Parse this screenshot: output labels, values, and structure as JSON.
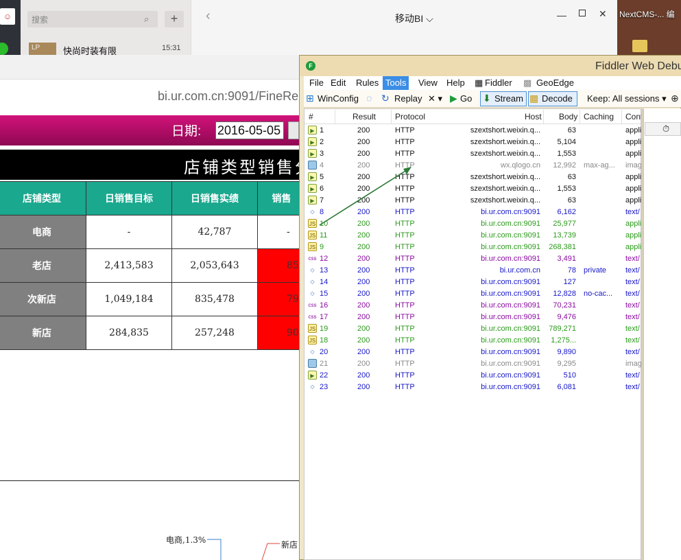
{
  "wechat": {
    "search_placeholder": "搜索",
    "add_label": "+",
    "chat_thumb": "LP",
    "chat_name": "快尚时装有限",
    "chat_time": "15:31",
    "window_title": "移动BI ⌵"
  },
  "desktop": {
    "icon_label": "NextCMS-...  编"
  },
  "browser": {
    "url": "bi.ur.com.cn:9091/FineRepo",
    "date_label": "日期:",
    "date_value": "2016-05-05",
    "report_title": "店铺类型销售分",
    "table": {
      "headers": [
        "店铺类型",
        "日销售目标",
        "日销售实绩",
        "销售"
      ],
      "rows": [
        {
          "type": "电商",
          "target": "-",
          "actual": "42,787",
          "rate": "-"
        },
        {
          "type": "老店",
          "target": "2,413,583",
          "actual": "2,053,643",
          "rate": "85"
        },
        {
          "type": "次新店",
          "target": "1,049,184",
          "actual": "835,478",
          "rate": "79"
        },
        {
          "type": "新店",
          "target": "284,835",
          "actual": "257,248",
          "rate": "90"
        }
      ]
    },
    "pie_labels": [
      "电商,1.3%",
      "新店"
    ]
  },
  "fiddler": {
    "title": "Fiddler Web Debu",
    "menu": [
      "File",
      "Edit",
      "Rules",
      "Tools",
      "View",
      "Help",
      "Fiddler",
      "GeoEdge"
    ],
    "active_menu": "Tools",
    "toolbar": {
      "winconfig": "WinConfig",
      "replay": "Replay",
      "remove": "✕ ▾",
      "go": "Go",
      "stream": "Stream",
      "decode": "Decode",
      "keep": "Keep: All sessions ▾"
    },
    "columns": [
      "#",
      "Result",
      "Protocol",
      "Host",
      "Body",
      "Caching",
      "Cont"
    ],
    "sessions": [
      {
        "id": "1",
        "result": "200",
        "protocol": "HTTP",
        "host": "szextshort.weixin.q...",
        "body": "63",
        "caching": "",
        "ctype": "appli",
        "icon": "resp",
        "color": "black"
      },
      {
        "id": "2",
        "result": "200",
        "protocol": "HTTP",
        "host": "szextshort.weixin.q...",
        "body": "5,104",
        "caching": "",
        "ctype": "appli",
        "icon": "resp",
        "color": "black"
      },
      {
        "id": "3",
        "result": "200",
        "protocol": "HTTP",
        "host": "szextshort.weixin.q...",
        "body": "1,553",
        "caching": "",
        "ctype": "appli",
        "icon": "resp",
        "color": "black"
      },
      {
        "id": "4",
        "result": "200",
        "protocol": "HTTP",
        "host": "wx.qlogo.cn",
        "body": "12,992",
        "caching": "max-ag...",
        "ctype": "imag",
        "icon": "img",
        "color": "gray"
      },
      {
        "id": "5",
        "result": "200",
        "protocol": "HTTP",
        "host": "szextshort.weixin.q...",
        "body": "63",
        "caching": "",
        "ctype": "appli",
        "icon": "resp",
        "color": "black"
      },
      {
        "id": "6",
        "result": "200",
        "protocol": "HTTP",
        "host": "szextshort.weixin.q...",
        "body": "1,553",
        "caching": "",
        "ctype": "appli",
        "icon": "resp",
        "color": "black"
      },
      {
        "id": "7",
        "result": "200",
        "protocol": "HTTP",
        "host": "szextshort.weixin.q...",
        "body": "63",
        "caching": "",
        "ctype": "appli",
        "icon": "resp",
        "color": "black"
      },
      {
        "id": "8",
        "result": "200",
        "protocol": "HTTP",
        "host": "bi.ur.com.cn:9091",
        "body": "6,162",
        "caching": "",
        "ctype": "text/",
        "icon": "html",
        "color": "blue"
      },
      {
        "id": "10",
        "result": "200",
        "protocol": "HTTP",
        "host": "bi.ur.com.cn:9091",
        "body": "25,977",
        "caching": "",
        "ctype": "appli",
        "icon": "js",
        "color": "green"
      },
      {
        "id": "11",
        "result": "200",
        "protocol": "HTTP",
        "host": "bi.ur.com.cn:9091",
        "body": "13,739",
        "caching": "",
        "ctype": "appli",
        "icon": "js",
        "color": "green"
      },
      {
        "id": "9",
        "result": "200",
        "protocol": "HTTP",
        "host": "bi.ur.com.cn:9091",
        "body": "268,381",
        "caching": "",
        "ctype": "appli",
        "icon": "js",
        "color": "green"
      },
      {
        "id": "12",
        "result": "200",
        "protocol": "HTTP",
        "host": "bi.ur.com.cn:9091",
        "body": "3,491",
        "caching": "",
        "ctype": "text/",
        "icon": "css",
        "color": "purple"
      },
      {
        "id": "13",
        "result": "200",
        "protocol": "HTTP",
        "host": "bi.ur.com.cn",
        "body": "78",
        "caching": "private",
        "ctype": "text/",
        "icon": "html",
        "color": "blue"
      },
      {
        "id": "14",
        "result": "200",
        "protocol": "HTTP",
        "host": "bi.ur.com.cn:9091",
        "body": "127",
        "caching": "",
        "ctype": "text/",
        "icon": "html",
        "color": "blue"
      },
      {
        "id": "15",
        "result": "200",
        "protocol": "HTTP",
        "host": "bi.ur.com.cn:9091",
        "body": "12,828",
        "caching": "no-cac...",
        "ctype": "text/",
        "icon": "html",
        "color": "blue"
      },
      {
        "id": "16",
        "result": "200",
        "protocol": "HTTP",
        "host": "bi.ur.com.cn:9091",
        "body": "70,231",
        "caching": "",
        "ctype": "text/",
        "icon": "css",
        "color": "purple"
      },
      {
        "id": "17",
        "result": "200",
        "protocol": "HTTP",
        "host": "bi.ur.com.cn:9091",
        "body": "9,476",
        "caching": "",
        "ctype": "text/",
        "icon": "css",
        "color": "purple"
      },
      {
        "id": "19",
        "result": "200",
        "protocol": "HTTP",
        "host": "bi.ur.com.cn:9091",
        "body": "789,271",
        "caching": "",
        "ctype": "text/",
        "icon": "js",
        "color": "green"
      },
      {
        "id": "18",
        "result": "200",
        "protocol": "HTTP",
        "host": "bi.ur.com.cn:9091",
        "body": "1,275...",
        "caching": "",
        "ctype": "text/",
        "icon": "js",
        "color": "green"
      },
      {
        "id": "20",
        "result": "200",
        "protocol": "HTTP",
        "host": "bi.ur.com.cn:9091",
        "body": "9,890",
        "caching": "",
        "ctype": "text/",
        "icon": "html",
        "color": "blue"
      },
      {
        "id": "21",
        "result": "200",
        "protocol": "HTTP",
        "host": "bi.ur.com.cn:9091",
        "body": "9,295",
        "caching": "",
        "ctype": "imag",
        "icon": "img",
        "color": "gray"
      },
      {
        "id": "22",
        "result": "200",
        "protocol": "HTTP",
        "host": "bi.ur.com.cn:9091",
        "body": "510",
        "caching": "",
        "ctype": "text/",
        "icon": "resp",
        "color": "blue"
      },
      {
        "id": "23",
        "result": "200",
        "protocol": "HTTP",
        "host": "bi.ur.com.cn:9091",
        "body": "6,081",
        "caching": "",
        "ctype": "text/",
        "icon": "html",
        "color": "blue"
      }
    ]
  }
}
